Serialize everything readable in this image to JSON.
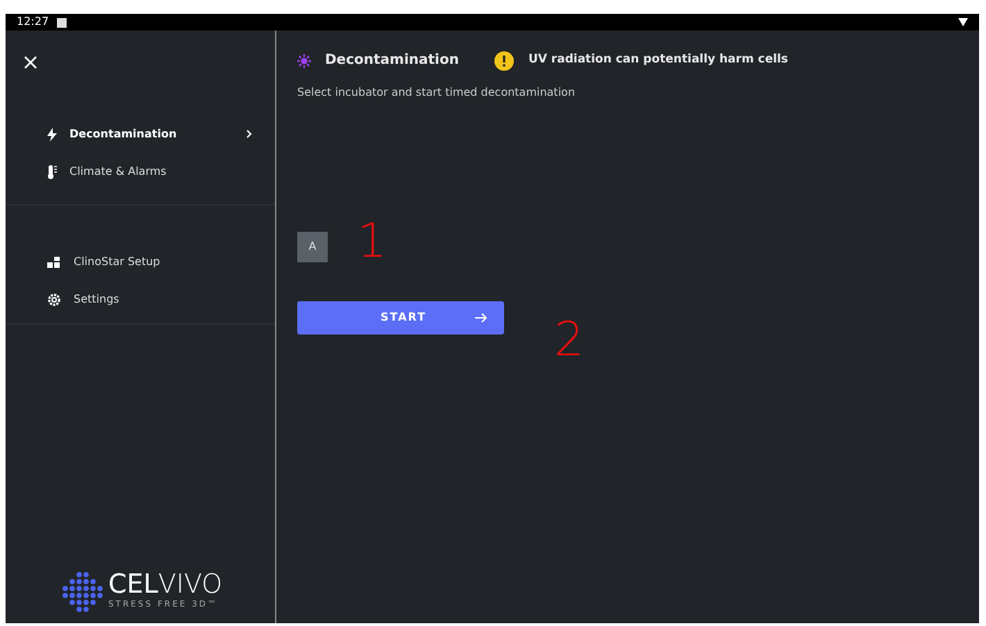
{
  "status_bar": {
    "time": "12:27"
  },
  "sidebar": {
    "groups": [
      {
        "items": [
          {
            "label": "Decontamination",
            "selected": true
          },
          {
            "label": "Climate & Alarms",
            "selected": false
          }
        ]
      },
      {
        "items": [
          {
            "label": "ClinoStar Setup",
            "selected": false
          },
          {
            "label": "Settings",
            "selected": false
          }
        ]
      }
    ]
  },
  "logo": {
    "name": "**CEL**VIVO",
    "tagline": "STRESS FREE 3D™"
  },
  "main": {
    "title": "Decontamination",
    "warning": "UV radiation can potentially harm cells",
    "instruction": "Select incubator and start timed decontamination",
    "incubators": [
      {
        "label": "A"
      }
    ],
    "start_button": {
      "label": "START"
    },
    "annotations": [
      "1",
      "2"
    ]
  }
}
